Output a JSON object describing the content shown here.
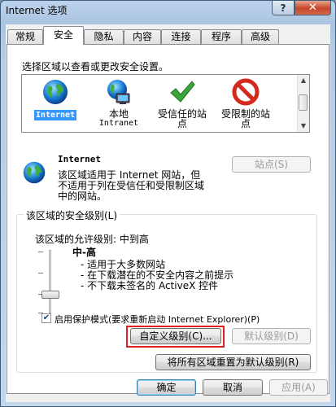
{
  "window": {
    "title": "Internet 选项"
  },
  "titlebar": {
    "help": "?",
    "close": "x"
  },
  "tabs": [
    {
      "label": "常规"
    },
    {
      "label": "安全",
      "active": true
    },
    {
      "label": "隐私"
    },
    {
      "label": "内容"
    },
    {
      "label": "连接"
    },
    {
      "label": "程序"
    },
    {
      "label": "高级"
    }
  ],
  "security": {
    "select_zone_label": "选择区域以查看或更改安全设置。",
    "zones": [
      {
        "label": "Internet",
        "label2": "",
        "icon": "globe-icon",
        "selected": true
      },
      {
        "label": "本地",
        "label2": "Intranet",
        "icon": "local-intranet-icon"
      },
      {
        "label": "受信任的站",
        "label2": "点",
        "icon": "checkmark-icon"
      },
      {
        "label": "受限制的站",
        "label2": "点",
        "icon": "no-entry-icon"
      }
    ],
    "zone_title": "Internet",
    "zone_desc_1": "该区域适用于 Internet 网站，但",
    "zone_desc_2": "不适用于列在受信任和受限制区域",
    "zone_desc_3": "中的网站。",
    "sites_button": "站点(S)",
    "level_group_label": "该区域的安全级别(L)",
    "allowed_levels": "该区域的允许级别: 中到高",
    "level_name": "中-高",
    "bullets": [
      "- 适用于大多数网站",
      "- 在下载潜在的不安全内容之前提示",
      "- 不下载未签名的 ActiveX 控件"
    ],
    "protected_mode_label": "启用保护模式(要求重新启动 Internet Explorer)(P)",
    "protected_mode_checked": true,
    "custom_level_button": "自定义级别(C)...",
    "default_level_button": "默认级别(D)",
    "reset_all_button": "将所有区域重置为默认级别(R)"
  },
  "footer": {
    "ok": "确定",
    "cancel": "取消",
    "apply": "应用(A)"
  },
  "colors": {
    "selection": "#3399ff",
    "highlight_frame": "#e02020",
    "trusted_green": "#3aa53a",
    "restricted_red": "#d42a1e"
  }
}
